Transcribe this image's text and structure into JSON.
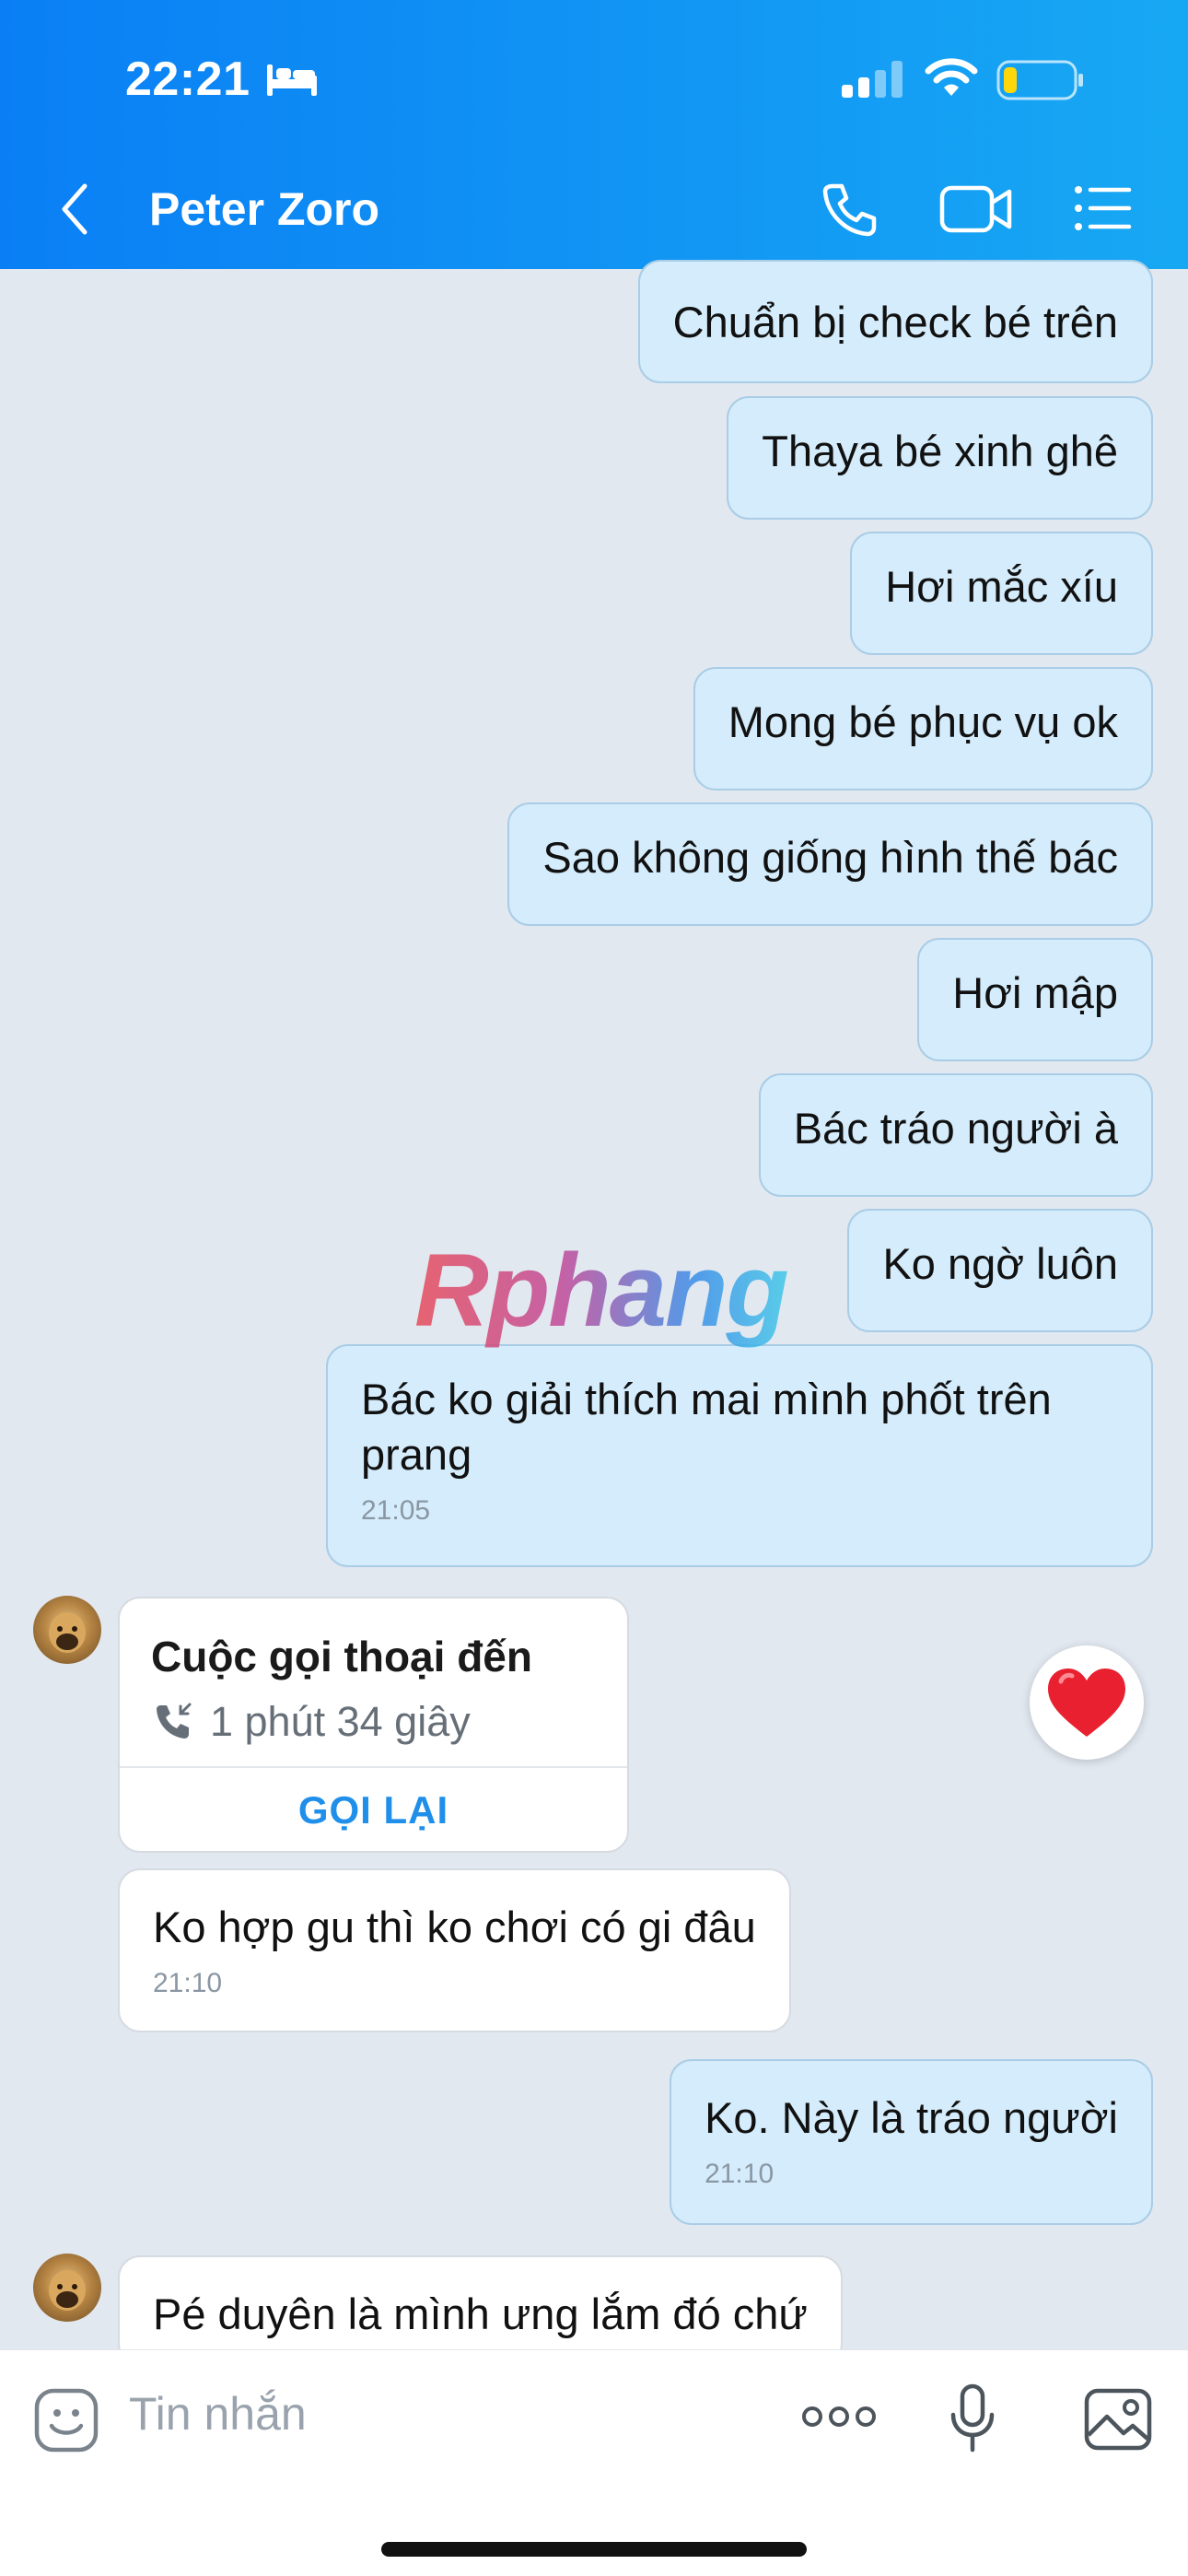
{
  "status": {
    "time": "22:21"
  },
  "header": {
    "contact_name": "Peter Zoro"
  },
  "messages": [
    {
      "dir": "out",
      "text": "Chuẩn bị check bé trên"
    },
    {
      "dir": "out",
      "text": "Thaya bé xinh ghê"
    },
    {
      "dir": "out",
      "text": "Hơi mắc xíu"
    },
    {
      "dir": "out",
      "text": "Mong bé phục vụ ok"
    },
    {
      "dir": "out",
      "text": "Sao không giống hình thế bác"
    },
    {
      "dir": "out",
      "text": "Hơi mập"
    },
    {
      "dir": "out",
      "text": "Bác tráo người à"
    },
    {
      "dir": "out",
      "text": "Ko ngờ luôn"
    },
    {
      "dir": "out",
      "text": "Bác ko giải thích mai mình phốt trên prang",
      "time": "21:05"
    },
    {
      "dir": "in",
      "text": "Ko hợp gu thì ko chơi có gi đâu",
      "time": "21:10"
    },
    {
      "dir": "out",
      "text": "Ko. Này là tráo người",
      "time": "21:10"
    },
    {
      "dir": "in",
      "text": "Pé duyên là mình ưng lắm đó chứ"
    }
  ],
  "call_card": {
    "title": "Cuộc gọi thoại đến",
    "duration": "1 phút 34 giây",
    "callback_label": "GỌI LẠI"
  },
  "watermark": "Rphang",
  "input": {
    "placeholder": "Tin nhắn"
  },
  "colors": {
    "header_start": "#0a7ff5",
    "header_end": "#17a8f3",
    "outgoing_bubble": "#d4ecfb",
    "incoming_bubble": "#ffffff",
    "chat_background": "#e2e8f0",
    "callback_text": "#1f8fea"
  },
  "icons": [
    "bed-icon",
    "signal-icon",
    "wifi-icon",
    "battery-icon",
    "back-icon",
    "phone-icon",
    "video-icon",
    "list-icon",
    "heart-icon",
    "emoji-icon",
    "more-icon",
    "mic-icon",
    "image-icon"
  ]
}
